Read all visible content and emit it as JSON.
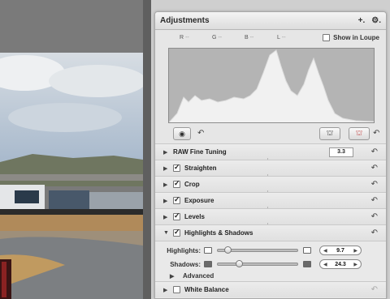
{
  "hud": {
    "title": "Adjustments",
    "add_button": "+.",
    "gear_button": "⚙.",
    "channels": [
      {
        "key": "R",
        "value": "--"
      },
      {
        "key": "G",
        "value": "--"
      },
      {
        "key": "B",
        "value": "--"
      },
      {
        "key": "L",
        "value": "--"
      }
    ],
    "show_in_loupe": "Show in Loupe"
  },
  "adjustments": [
    {
      "label": "RAW Fine Tuning",
      "checkbox": false,
      "expanded": false,
      "version": "3.3"
    },
    {
      "label": "Straighten",
      "checkbox": true,
      "expanded": false
    },
    {
      "label": "Crop",
      "checkbox": true,
      "expanded": false
    },
    {
      "label": "Exposure",
      "checkbox": true,
      "expanded": false
    },
    {
      "label": "Levels",
      "checkbox": true,
      "expanded": false
    },
    {
      "label": "Highlights & Shadows",
      "checkbox": true,
      "expanded": true
    },
    {
      "label": "White Balance",
      "checkbox": false,
      "expanded": false
    }
  ],
  "highlights_shadows": {
    "highlights_label": "Highlights:",
    "highlights_value": "9.7",
    "shadows_label": "Shadows:",
    "shadows_value": "24.3",
    "advanced_label": "Advanced"
  },
  "icons": {
    "undo": "↶",
    "expand_triangle": "▶",
    "collapse_triangle": "▼"
  }
}
